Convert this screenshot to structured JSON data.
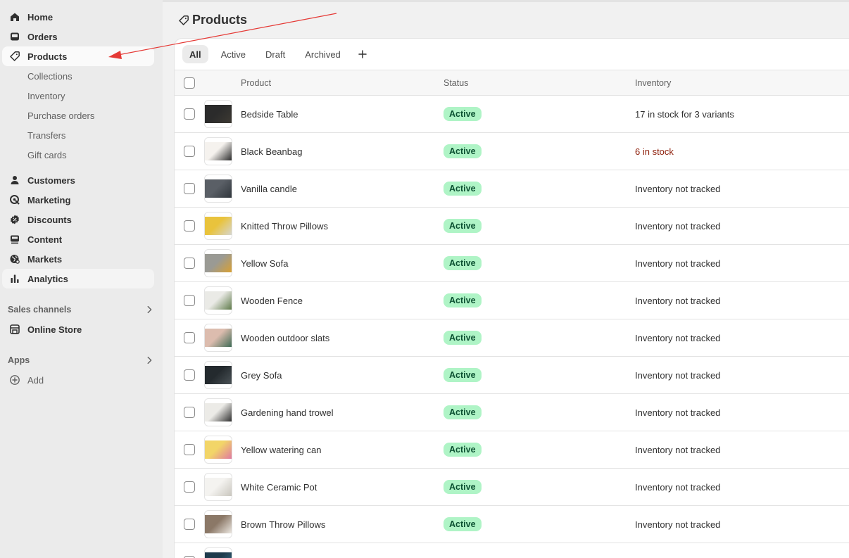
{
  "sidebar": {
    "main": [
      {
        "label": "Home",
        "icon": "home-icon"
      },
      {
        "label": "Orders",
        "icon": "inbox-icon"
      },
      {
        "label": "Products",
        "icon": "tag-icon"
      }
    ],
    "products_sub": [
      "Collections",
      "Inventory",
      "Purchase orders",
      "Transfers",
      "Gift cards"
    ],
    "secondary": [
      {
        "label": "Customers",
        "icon": "person-icon"
      },
      {
        "label": "Marketing",
        "icon": "target-icon"
      },
      {
        "label": "Discounts",
        "icon": "discount-icon"
      },
      {
        "label": "Content",
        "icon": "content-icon"
      },
      {
        "label": "Markets",
        "icon": "globe-icon"
      },
      {
        "label": "Analytics",
        "icon": "bar-chart-icon"
      }
    ],
    "sales_channels_label": "Sales channels",
    "online_store_label": "Online Store",
    "apps_label": "Apps",
    "add_label": "Add"
  },
  "page": {
    "title": "Products"
  },
  "tabs": [
    "All",
    "Active",
    "Draft",
    "Archived"
  ],
  "table": {
    "headers": {
      "product": "Product",
      "status": "Status",
      "inventory": "Inventory"
    },
    "rows": [
      {
        "name": "Bedside Table",
        "status": "Active",
        "inventory": "17 in stock for 3 variants",
        "low": false,
        "thumb": [
          "#2b2b2b",
          "#3d3a33"
        ]
      },
      {
        "name": "Black Beanbag",
        "status": "Active",
        "inventory": "6 in stock",
        "low": true,
        "thumb": [
          "#f5f2ee",
          "#2a2a2a"
        ]
      },
      {
        "name": "Vanilla candle",
        "status": "Active",
        "inventory": "Inventory not tracked",
        "low": false,
        "thumb": [
          "#5a5f66",
          "#30363c"
        ]
      },
      {
        "name": "Knitted Throw Pillows",
        "status": "Active",
        "inventory": "Inventory not tracked",
        "low": false,
        "thumb": [
          "#e9c33c",
          "#d6d6d0"
        ]
      },
      {
        "name": "Yellow Sofa",
        "status": "Active",
        "inventory": "Inventory not tracked",
        "low": false,
        "thumb": [
          "#9a9a94",
          "#d9a032"
        ]
      },
      {
        "name": "Wooden Fence",
        "status": "Active",
        "inventory": "Inventory not tracked",
        "low": false,
        "thumb": [
          "#eaeae6",
          "#5f7a4a"
        ]
      },
      {
        "name": "Wooden outdoor slats",
        "status": "Active",
        "inventory": "Inventory not tracked",
        "low": false,
        "thumb": [
          "#dcbcae",
          "#3e6b55"
        ]
      },
      {
        "name": "Grey Sofa",
        "status": "Active",
        "inventory": "Inventory not tracked",
        "low": false,
        "thumb": [
          "#242a2e",
          "#4b5357"
        ]
      },
      {
        "name": "Gardening hand trowel",
        "status": "Active",
        "inventory": "Inventory not tracked",
        "low": false,
        "thumb": [
          "#ecebe7",
          "#2e2e2e"
        ]
      },
      {
        "name": "Yellow watering can",
        "status": "Active",
        "inventory": "Inventory not tracked",
        "low": false,
        "thumb": [
          "#f2d568",
          "#e07aa0"
        ]
      },
      {
        "name": "White Ceramic Pot",
        "status": "Active",
        "inventory": "Inventory not tracked",
        "low": false,
        "thumb": [
          "#f4f3f0",
          "#c9c6be"
        ]
      },
      {
        "name": "Brown Throw Pillows",
        "status": "Active",
        "inventory": "Inventory not tracked",
        "low": false,
        "thumb": [
          "#8b7867",
          "#ece8e2"
        ]
      },
      {
        "name": "",
        "status": "",
        "inventory": "",
        "low": false,
        "thumb": [
          "#1e3b4c",
          "#3a6f88"
        ]
      }
    ]
  },
  "colors": {
    "active_badge_bg": "#aff4c6",
    "active_badge_text": "#0c5132",
    "low_stock_text": "#8e1f0b",
    "annotation_arrow": "#e53935"
  }
}
